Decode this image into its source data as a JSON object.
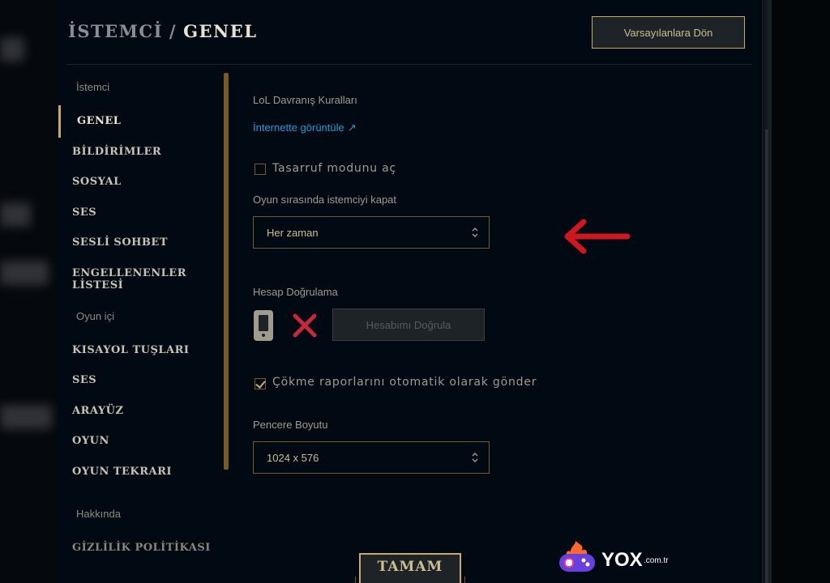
{
  "header": {
    "breadcrumb_parent": "İSTEMCİ",
    "separator": "/",
    "breadcrumb_current": "GENEL",
    "reset_button": "Varsayılanlara Dön"
  },
  "sidebar": {
    "sections": [
      {
        "label": "İstemci"
      },
      {
        "label": "Oyun içi"
      },
      {
        "label": "Hakkında"
      }
    ],
    "items": [
      {
        "label": "GENEL",
        "active": true
      },
      {
        "label": "BİLDİRİMLER"
      },
      {
        "label": "SOSYAL"
      },
      {
        "label": "SES"
      },
      {
        "label": "SESLİ SOHBET"
      },
      {
        "label": "ENGELLENENLER LİSTESİ"
      },
      {
        "label": "KISAYOL TUŞLARI"
      },
      {
        "label": "SES"
      },
      {
        "label": "ARAYÜZ"
      },
      {
        "label": "OYUN"
      },
      {
        "label": "OYUN TEKRARI"
      },
      {
        "label": "GİZLİLİK POLİTİKASI"
      }
    ]
  },
  "content": {
    "conduct_label": "LoL Davranış Kuralları",
    "conduct_link": "İnternette görüntüle",
    "conduct_link_icon": "↗",
    "eco_mode_label": "Tasarruf modunu aç",
    "eco_mode_checked": false,
    "close_client_label": "Oyun sırasında istemciyi kapat",
    "close_client_value": "Her zaman",
    "account_verify_label": "Hesap Doğrulama",
    "account_verify_button": "Hesabımı Doğrula",
    "crash_report_label": "Çökme raporlarını otomatik olarak gönder",
    "crash_report_checked": true,
    "window_size_label": "Pencere Boyutu",
    "window_size_value": "1024 x 576"
  },
  "footer": {
    "ok_button": "TAMAM"
  },
  "watermark": {
    "brand": "YOX",
    "suffix": ".com.tr"
  },
  "colors": {
    "gold": "#c8aa6e",
    "gold_dark": "#785a28",
    "background": "#010a13",
    "link": "#1e9bd7",
    "annotation_red": "#d0161e"
  }
}
